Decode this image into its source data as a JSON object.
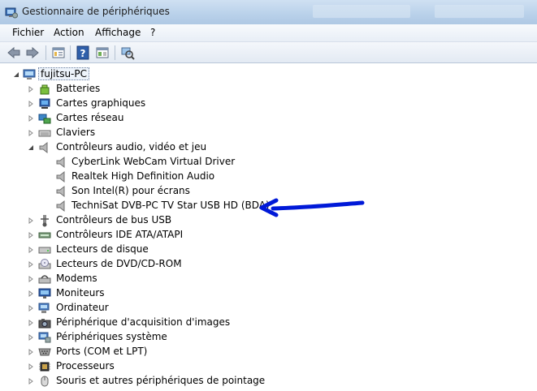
{
  "window": {
    "title": "Gestionnaire de périphériques"
  },
  "menu": {
    "items": [
      "Fichier",
      "Action",
      "Affichage",
      "?"
    ]
  },
  "toolbar": {
    "buttons": [
      "back-icon",
      "forward-icon",
      "properties-icon",
      "help-icon",
      "view-icon",
      "scan-hardware-icon"
    ]
  },
  "tree": {
    "root": "fujitsu-PC",
    "categories": [
      {
        "label": "Batteries",
        "icon": "battery-icon"
      },
      {
        "label": "Cartes graphiques",
        "icon": "display-adapter-icon"
      },
      {
        "label": "Cartes réseau",
        "icon": "network-adapter-icon"
      },
      {
        "label": "Claviers",
        "icon": "keyboard-icon"
      },
      {
        "label": "Contrôleurs audio, vidéo et jeu",
        "icon": "speaker-icon",
        "expanded": true,
        "children": [
          "CyberLink WebCam Virtual Driver",
          "Realtek High Definition Audio",
          "Son Intel(R) pour écrans",
          "TechniSat DVB-PC TV Star USB HD (BDA)"
        ]
      },
      {
        "label": "Contrôleurs de bus USB",
        "icon": "usb-icon"
      },
      {
        "label": "Contrôleurs IDE ATA/ATAPI",
        "icon": "ide-controller-icon"
      },
      {
        "label": "Lecteurs de disque",
        "icon": "disk-drive-icon"
      },
      {
        "label": "Lecteurs de DVD/CD-ROM",
        "icon": "dvd-drive-icon"
      },
      {
        "label": "Modems",
        "icon": "modem-icon"
      },
      {
        "label": "Moniteurs",
        "icon": "monitor-icon"
      },
      {
        "label": "Ordinateur",
        "icon": "computer-icon"
      },
      {
        "label": "Périphérique d'acquisition d'images",
        "icon": "camera-icon"
      },
      {
        "label": "Périphériques système",
        "icon": "system-devices-icon"
      },
      {
        "label": "Ports (COM et LPT)",
        "icon": "port-icon"
      },
      {
        "label": "Processeurs",
        "icon": "processor-icon"
      },
      {
        "label": "Souris et autres périphériques de pointage",
        "icon": "mouse-icon"
      }
    ]
  },
  "annotation": {
    "icon": "blue-arrow-annotation",
    "color": "#0019d8"
  }
}
